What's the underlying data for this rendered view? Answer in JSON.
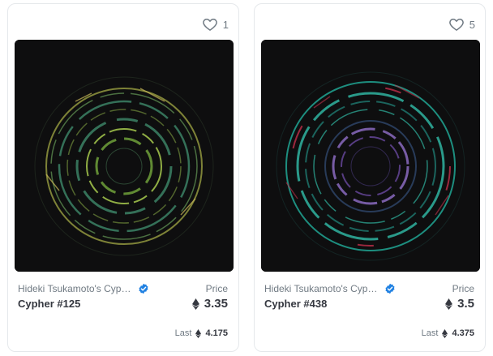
{
  "cards": [
    {
      "favorites": "1",
      "collection": "Hideki Tsukamoto's Cypher",
      "name": "Cypher #125",
      "price_label": "Price",
      "price": "3.35",
      "last_label": "Last",
      "last_price": "4.175",
      "art_colors": {
        "outer": "#8a8f3c",
        "mid": "#3f8a6a",
        "inner": "#9fc04a",
        "accent": "#c9b85a"
      }
    },
    {
      "favorites": "5",
      "collection": "Hideki Tsukamoto's Cypher",
      "name": "Cypher #438",
      "price_label": "Price",
      "price": "3.5",
      "last_label": "Last",
      "last_price": "4.375",
      "art_colors": {
        "outer": "#1f9c8c",
        "mid": "#2fb3a0",
        "inner": "#8a6ac0",
        "accent": "#c0304a"
      }
    }
  ],
  "colors": {
    "verified": "#2081e2",
    "text_muted": "#707a83",
    "text_main": "#353840",
    "art_bg": "#0e0e0f"
  },
  "icons": {
    "favorite": "heart-icon",
    "verified": "verified-badge-icon",
    "currency": "ethereum-icon"
  }
}
